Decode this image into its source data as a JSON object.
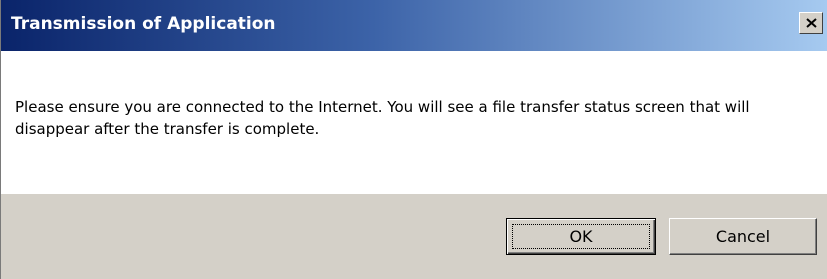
{
  "window": {
    "title": "Transmission of Application",
    "close_icon": "close-icon"
  },
  "message": {
    "text": "Please ensure you are connected to the Internet. You will see a file transfer status screen that will disappear after the transfer is complete."
  },
  "buttons": {
    "ok_label": "OK",
    "cancel_label": "Cancel"
  },
  "colors": {
    "titlebar_start": "#0a246a",
    "titlebar_end": "#a6caf0",
    "face": "#d4d0c8",
    "content_bg": "#ffffff"
  }
}
